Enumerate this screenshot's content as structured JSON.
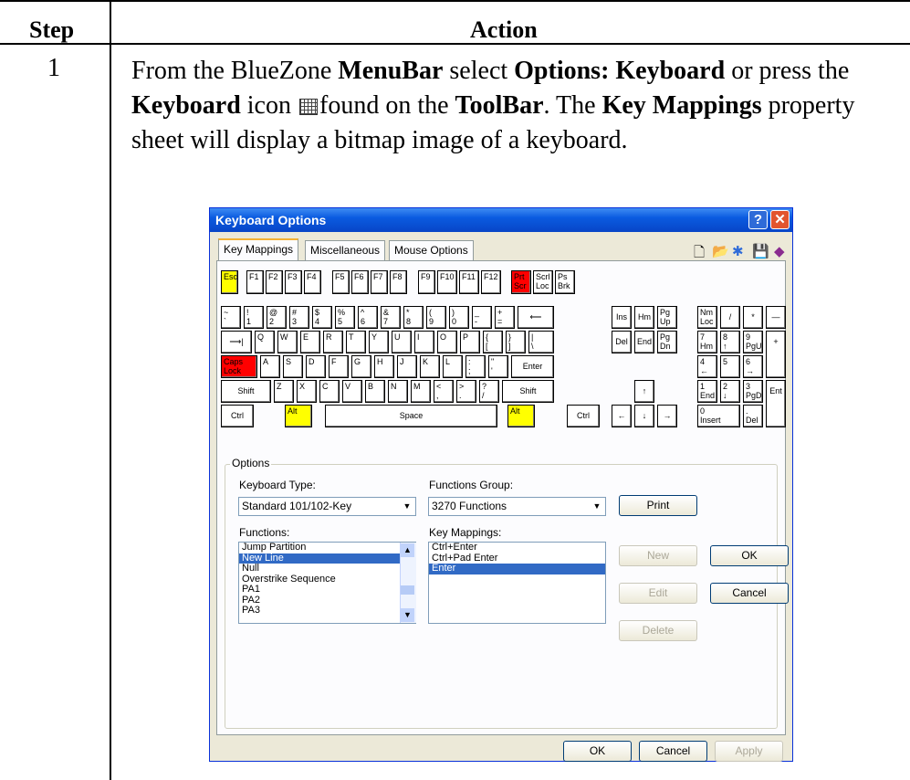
{
  "table": {
    "header_step": "Step",
    "header_action": "Action",
    "row_step": "1"
  },
  "instruction": {
    "t1": "From the BlueZone ",
    "b1": "MenuBar",
    "t2": " select ",
    "b2": "Options: Keyboard",
    "t3": " or press the ",
    "b3": "Keyboard",
    "t4": " icon ",
    "t5": "found on the ",
    "b4": "ToolBar",
    "t6": ".  The ",
    "b5": "Key Mappings",
    "t7": " property sheet will display a bitmap image of a keyboard."
  },
  "dialog": {
    "title": "Keyboard Options",
    "help_btn": "?",
    "close_btn": "✕",
    "tabs": [
      "Key Mappings",
      "Miscellaneous",
      "Mouse Options"
    ],
    "keys": {
      "esc": "Esc",
      "f1": "F1",
      "f2": "F2",
      "f3": "F3",
      "f4": "F4",
      "f5": "F5",
      "f6": "F6",
      "f7": "F7",
      "f8": "F8",
      "f9": "F9",
      "f10": "F10",
      "f11": "F11",
      "f12": "F12",
      "prtsc": "Prt\nScr",
      "scrlloc": "Scrl\nLoc",
      "psbrk": "Ps\nBrk",
      "tilde": "~\n`",
      "k1": "!\n1",
      "k2": "@\n2",
      "k3": "#\n3",
      "k4": "$\n4",
      "k5": "%\n5",
      "k6": "^\n6",
      "k7": "&\n7",
      "k8": "*\n8",
      "k9": "(\n9",
      "k0": ")\n0",
      "minus": "_\n-",
      "equals": "+\n=",
      "back": "⟵",
      "ins": "Ins",
      "hm": "Hm",
      "pgup": "Pg\nUp",
      "numloc": "Nm\nLoc",
      "div": "/",
      "mul": "*",
      "sub": "—",
      "tab": "⟶|",
      "q": "Q",
      "w": "W",
      "e": "E",
      "r": "R",
      "t": "T",
      "y": "Y",
      "u": "U",
      "i": "I",
      "o": "O",
      "p": "P",
      "lbr": "{\n[",
      "rbr": "}\n]",
      "bsl": "|\n\\",
      "del": "Del",
      "end": "End",
      "pgdn": "Pg\nDn",
      "n7": "7\nHm",
      "n8": "8\n↑",
      "n9": "9\nPgU",
      "add": "+",
      "caps": "Caps\nLock",
      "a": "A",
      "s": "S",
      "d": "D",
      "f": "F",
      "g": "G",
      "h": "H",
      "j": "J",
      "k": "K",
      "l": "L",
      "semi": ":\n;",
      "quote": "\"\n'",
      "enter": "Enter",
      "n4": "4\n←",
      "n5": "5",
      "n6": "6\n→",
      "lshift": "Shift",
      "z": "Z",
      "x": "X",
      "c": "C",
      "v": "V",
      "b": "B",
      "n": "N",
      "m": "M",
      "comma": "<\n,",
      "period": ">\n.",
      "slash": "?\n/",
      "rshift": "Shift",
      "up": "↑",
      "n1": "1\nEnd",
      "n2": "2\n↓",
      "n3": "3\nPgD",
      "nent": "Ent",
      "lctrl": "Ctrl",
      "lalt": "Alt",
      "space": "Space",
      "ralt": "Alt",
      "rctrl": "Ctrl",
      "left": "←",
      "down": "↓",
      "right": "→",
      "n0": "0\nInsert",
      "ndel": ".\nDel"
    },
    "options_label": "Options",
    "keyboard_type_label": "Keyboard Type:",
    "keyboard_type_value": "Standard 101/102-Key",
    "functions_group_label": "Functions Group:",
    "functions_group_value": "3270 Functions",
    "print_btn": "Print",
    "functions_label": "Functions:",
    "functions": [
      "Jump Partition",
      "New Line",
      "Null",
      "Overstrike Sequence",
      "PA1",
      "PA2",
      "PA3"
    ],
    "functions_selected": "New Line",
    "key_mappings_label": "Key Mappings:",
    "key_mappings": [
      "Ctrl+Enter",
      "Ctrl+Pad Enter",
      "Enter"
    ],
    "key_mappings_selected": "Enter",
    "new_btn": "New",
    "edit_btn": "Edit",
    "delete_btn": "Delete",
    "ok_btn": "OK",
    "cancel_btn": "Cancel",
    "bottom_ok": "OK",
    "bottom_cancel": "Cancel",
    "bottom_apply": "Apply"
  }
}
